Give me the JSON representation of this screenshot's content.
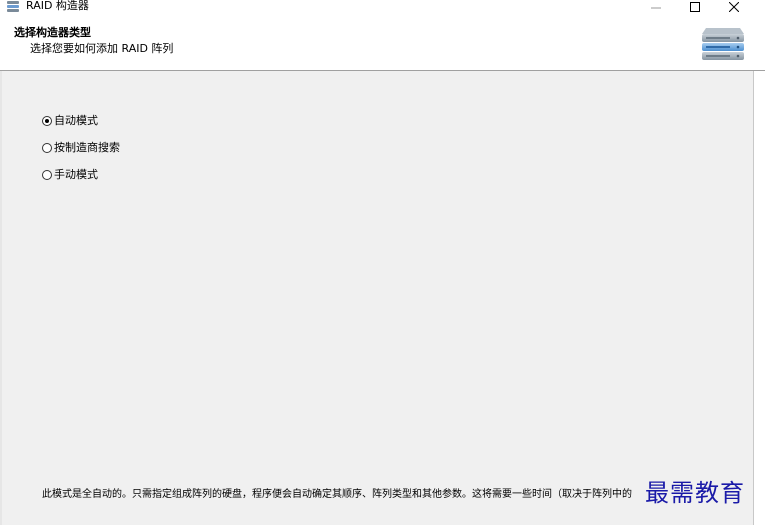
{
  "window": {
    "title": "RAID 构造器",
    "controls": {
      "minimize": "—",
      "maximize": "☐",
      "close": "✕"
    }
  },
  "header": {
    "title": "选择构造器类型",
    "subtitle": "选择您要如何添加 RAID 阵列",
    "icon": "server-stack-icon"
  },
  "options": [
    {
      "label": "自动模式",
      "selected": true
    },
    {
      "label": "按制造商搜索",
      "selected": false
    },
    {
      "label": "手动模式",
      "selected": false
    }
  ],
  "description": "此模式是全自动的。只需指定组成阵列的硬盘，程序便会自动确定其顺序、阵列类型和其他参数。这将需要一些时间（取决于阵列中的",
  "watermark": "最需教育",
  "colors": {
    "content_bg": "#f0f0f0",
    "watermark": "#1a1aa8"
  }
}
